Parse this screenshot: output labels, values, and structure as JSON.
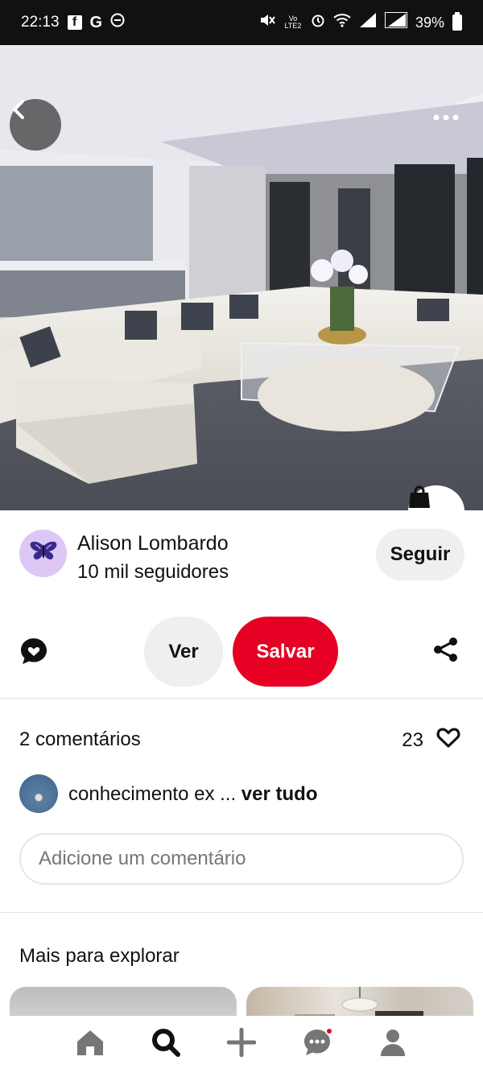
{
  "status_bar": {
    "time": "22:13",
    "left_icons": [
      "facebook-icon",
      "google-icon",
      "do-not-disturb-icon"
    ],
    "right_icons": [
      "mute-icon",
      "volte-icon",
      "alarm-icon",
      "wifi-icon",
      "signal-icon",
      "signal-icon",
      "battery-icon"
    ],
    "volte_label": "Vo LTE2",
    "battery": "39%"
  },
  "hero": {
    "back_icon": "chevron-left-icon",
    "more_icon": "more-dots-icon",
    "shop_icon": "shopping-bag-icon"
  },
  "profile": {
    "name": "Alison Lombardo",
    "followers": "10 mil seguidores",
    "follow_label": "Seguir",
    "avatar_icon": "butterfly-icon"
  },
  "actions": {
    "comment_icon": "comment-heart-icon",
    "ver_label": "Ver",
    "save_label": "Salvar",
    "share_icon": "share-icon"
  },
  "comments": {
    "count_label": "2 comentários",
    "likes": "23",
    "preview_text": "conhecimento ex ...",
    "see_all": "ver tudo",
    "input_placeholder": "Adicione um comentário"
  },
  "explore": {
    "title": "Mais para explorar"
  },
  "nav": {
    "items": [
      "home-icon",
      "search-icon",
      "add-icon",
      "messages-icon",
      "profile-icon"
    ]
  },
  "colors": {
    "accent": "#e60023",
    "status_bar": "#111111",
    "button_grey": "#efefef"
  }
}
